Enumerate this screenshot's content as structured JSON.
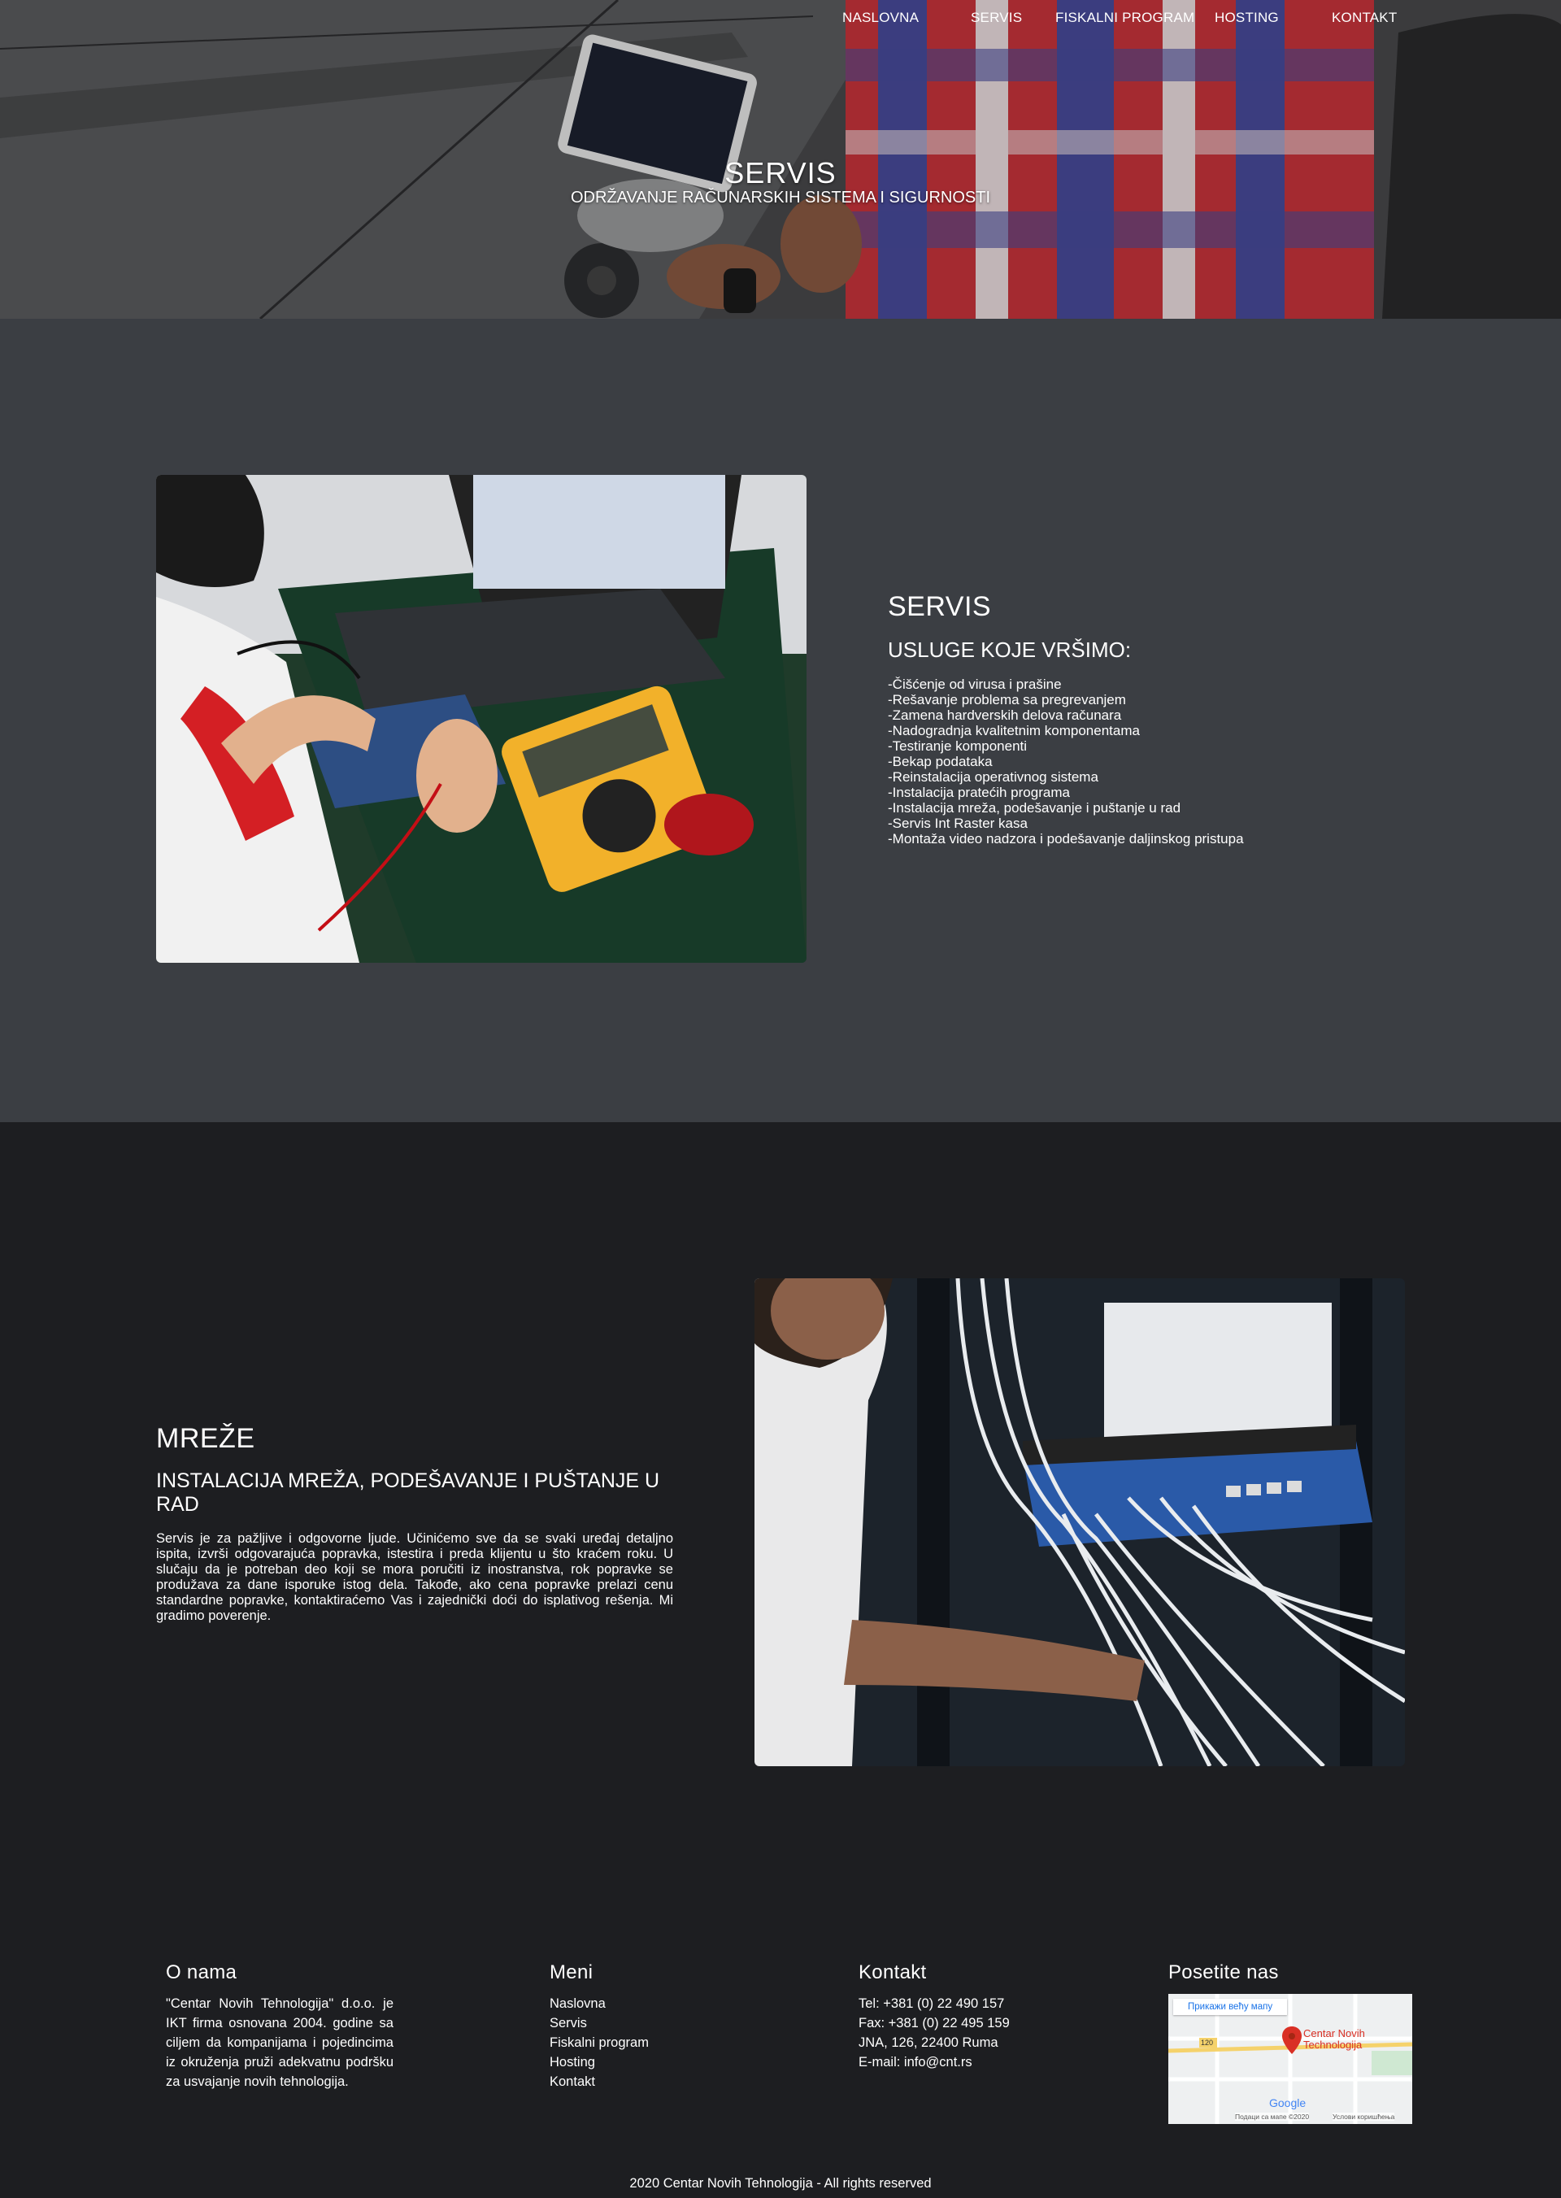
{
  "nav": {
    "items": [
      "NASLOVNA",
      "SERVIS",
      "FISKALNI PROGRAM",
      "HOSTING",
      "KONTAKT"
    ]
  },
  "hero": {
    "title": "SERVIS",
    "subtitle": "ODRŽAVANJE RAČUNARSKIH SISTEMA I SIGURNOSTI"
  },
  "servis": {
    "title": "SERVIS",
    "subtitle": "USLUGE KOJE VRŠIMO:",
    "items": [
      "-Čišćenje od virusa i prašine",
      "-Rešavanje problema sa pregrevanjem",
      "-Zamena hardverskih delova računara",
      "-Nadogradnja kvalitetnim komponentama",
      "-Testiranje komponenti",
      "-Bekap podataka",
      "-Reinstalacija operativnog sistema",
      "-Instalacija pratećih programa",
      "-Instalacija mreža, podešavanje i puštanje u rad",
      "-Servis Int Raster kasa",
      "-Montaža video nadzora i podešavanje daljinskog pristupa"
    ]
  },
  "mreze": {
    "title": "MREŽE",
    "subtitle": "INSTALACIJA MREŽA, PODEŠAVANJE I PUŠTANJE U RAD",
    "text": "Servis je za pažljive i odgovorne ljude. Učinićemo sve da se svaki uređaj detaljno ispita, izvrši odgovarajuća popravka, istestira i preda klijentu u što kraćem roku. U slučaju da je potreban deo koji se mora poručiti iz inostranstva, rok popravke se produžava za dane isporuke istog dela. Takođe, ako cena popravke prelazi cenu standardne popravke, kontaktiraćemo Vas i zajednički doći do isplativog rešenja. Mi gradimo poverenje."
  },
  "footer": {
    "about": {
      "title": "O nama",
      "text": "\"Centar Novih Tehnologija\" d.o.o. je IKT firma osnovana 2004. godine sa ciljem da kompanijama i pojedincima iz okruženja pruži adekvatnu podršku za usvajanje novih tehnologija."
    },
    "menu": {
      "title": "Meni",
      "items": [
        "Naslovna",
        "Servis",
        "Fiskalni program",
        "Hosting",
        "Kontakt"
      ]
    },
    "contact": {
      "title": "Kontakt",
      "items": [
        "Tel: +381 (0) 22 490 157",
        "Fax: +381 (0) 22 495 159",
        "JNA, 126, 22400 Ruma",
        "E-mail: info@cnt.rs"
      ]
    },
    "visit": {
      "title": "Posetite nas",
      "map_button": "Прикажи већу мапу",
      "map_place": "Centar Novih Technologija",
      "map_road": "120",
      "map_logo": "Google",
      "map_data": "Подаци са мапе ©2020",
      "map_terms": "Услови коришћења"
    },
    "copyright": "2020 Centar Novih Tehnologija - All rights reserved"
  },
  "colors": {
    "section_mid": "#3b3e43",
    "section_dark": "#1d1e21",
    "text": "#ffffff"
  },
  "icons": [
    "map-pin-icon"
  ]
}
